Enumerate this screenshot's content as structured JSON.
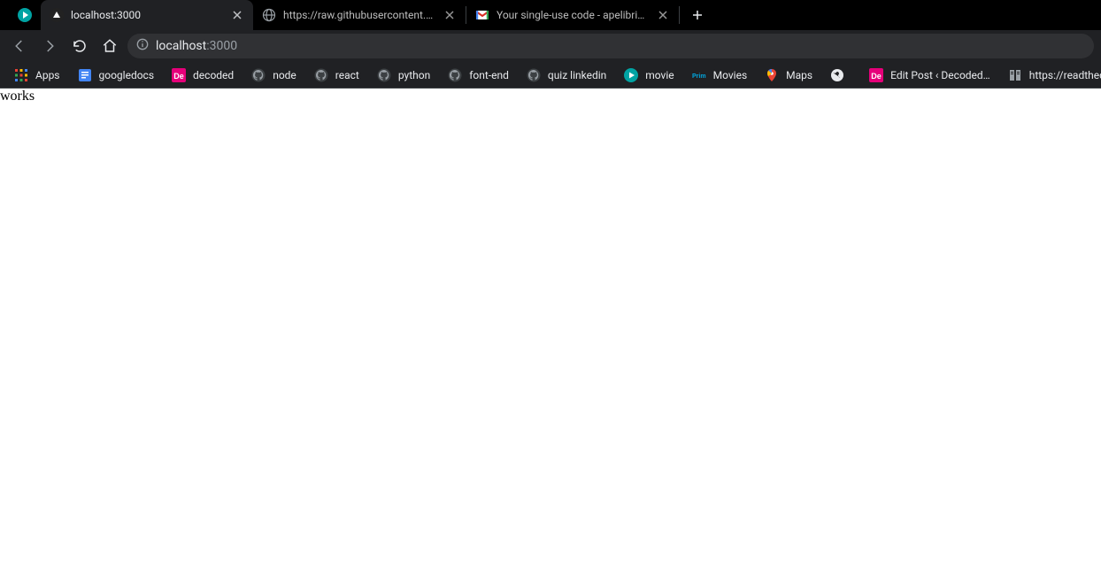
{
  "tabs": [
    {
      "title": "localhost:3000",
      "favicon": "triangle-dark"
    },
    {
      "title": "https://raw.githubusercontent.co",
      "favicon": "globe"
    },
    {
      "title": "Your single-use code - apelibrian",
      "favicon": "gmail"
    }
  ],
  "toolbar": {
    "url_host": "localhost",
    "url_rest": ":3000"
  },
  "bookmarks": [
    {
      "label": "Apps",
      "icon": "apps-grid"
    },
    {
      "label": "googledocs",
      "icon": "gdocs"
    },
    {
      "label": "decoded",
      "icon": "de-pink"
    },
    {
      "label": "node",
      "icon": "github"
    },
    {
      "label": "react",
      "icon": "github"
    },
    {
      "label": "python",
      "icon": "github"
    },
    {
      "label": "font-end",
      "icon": "github"
    },
    {
      "label": "quiz linkedin",
      "icon": "github"
    },
    {
      "label": "movie",
      "icon": "play-teal"
    },
    {
      "label": "Movies",
      "icon": "prime"
    },
    {
      "label": "Maps",
      "icon": "gmaps"
    },
    {
      "label": "",
      "icon": "globe-white"
    },
    {
      "label": "Edit Post ‹ Decoded…",
      "icon": "de-pink"
    },
    {
      "label": "https://readthedocs.…",
      "icon": "rtd"
    }
  ],
  "page": {
    "body_text": "works"
  }
}
